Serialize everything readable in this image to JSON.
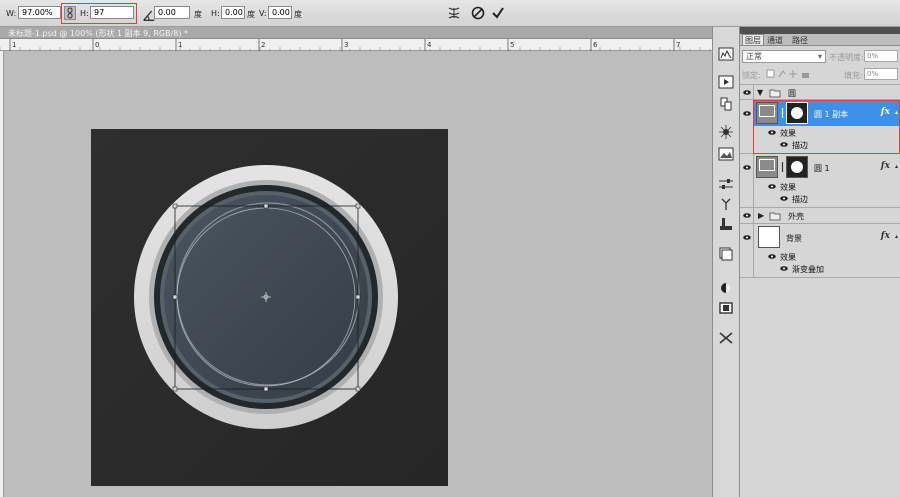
{
  "options_bar": {
    "w_label": "W:",
    "w_value": "97.00%",
    "h_label": "H:",
    "h_value": "97",
    "angle_value": "0.00",
    "angle_unit": "度",
    "hskew_label": "H:",
    "hskew_value": "0.00",
    "hskew_unit": "度",
    "vskew_label": "V:",
    "vskew_value": "0.00",
    "vskew_unit": "度",
    "warp_icon": "warp-mode-icon",
    "cancel_icon": "cancel-transform-icon",
    "commit_icon": "commit-transform-icon"
  },
  "document_tab": {
    "title": "未标题-1.psd @ 100% (形状 1 副本 9, RGB/8) *"
  },
  "ruler": {
    "labels": [
      "1",
      "0",
      "1",
      "2",
      "3",
      "4",
      "5",
      "6",
      "7"
    ]
  },
  "panel": {
    "tabs": [
      "图层",
      "通道",
      "路径"
    ],
    "blend_mode": "正常",
    "opacity_label": "不透明度:",
    "opacity_value": "0%",
    "lock_label": "锁定:",
    "fill_label": "填充:",
    "fill_value": "0%"
  },
  "layers": [
    {
      "kind": "group",
      "name": "圆",
      "expanded": true
    },
    {
      "kind": "shape",
      "name": "圆 1 副本",
      "selected": true,
      "fx": "fx",
      "effects_label": "效果",
      "effect": "描边"
    },
    {
      "kind": "shape",
      "name": "圆 1",
      "selected": false,
      "fx": "fx",
      "effects_label": "效果",
      "effect": "描边"
    },
    {
      "kind": "group",
      "name": "外壳",
      "expanded": false
    },
    {
      "kind": "background",
      "name": "背景",
      "fx": "fx",
      "effects_label": "效果",
      "effect": "渐变叠加"
    }
  ],
  "colors": {
    "selection_blue": "#3d8fe8",
    "highlight_red": "#e83a3a",
    "canvas_dark": "#2c2c2c",
    "ring_light": "#dcdcdc",
    "inner_disc": "#3f4850"
  }
}
